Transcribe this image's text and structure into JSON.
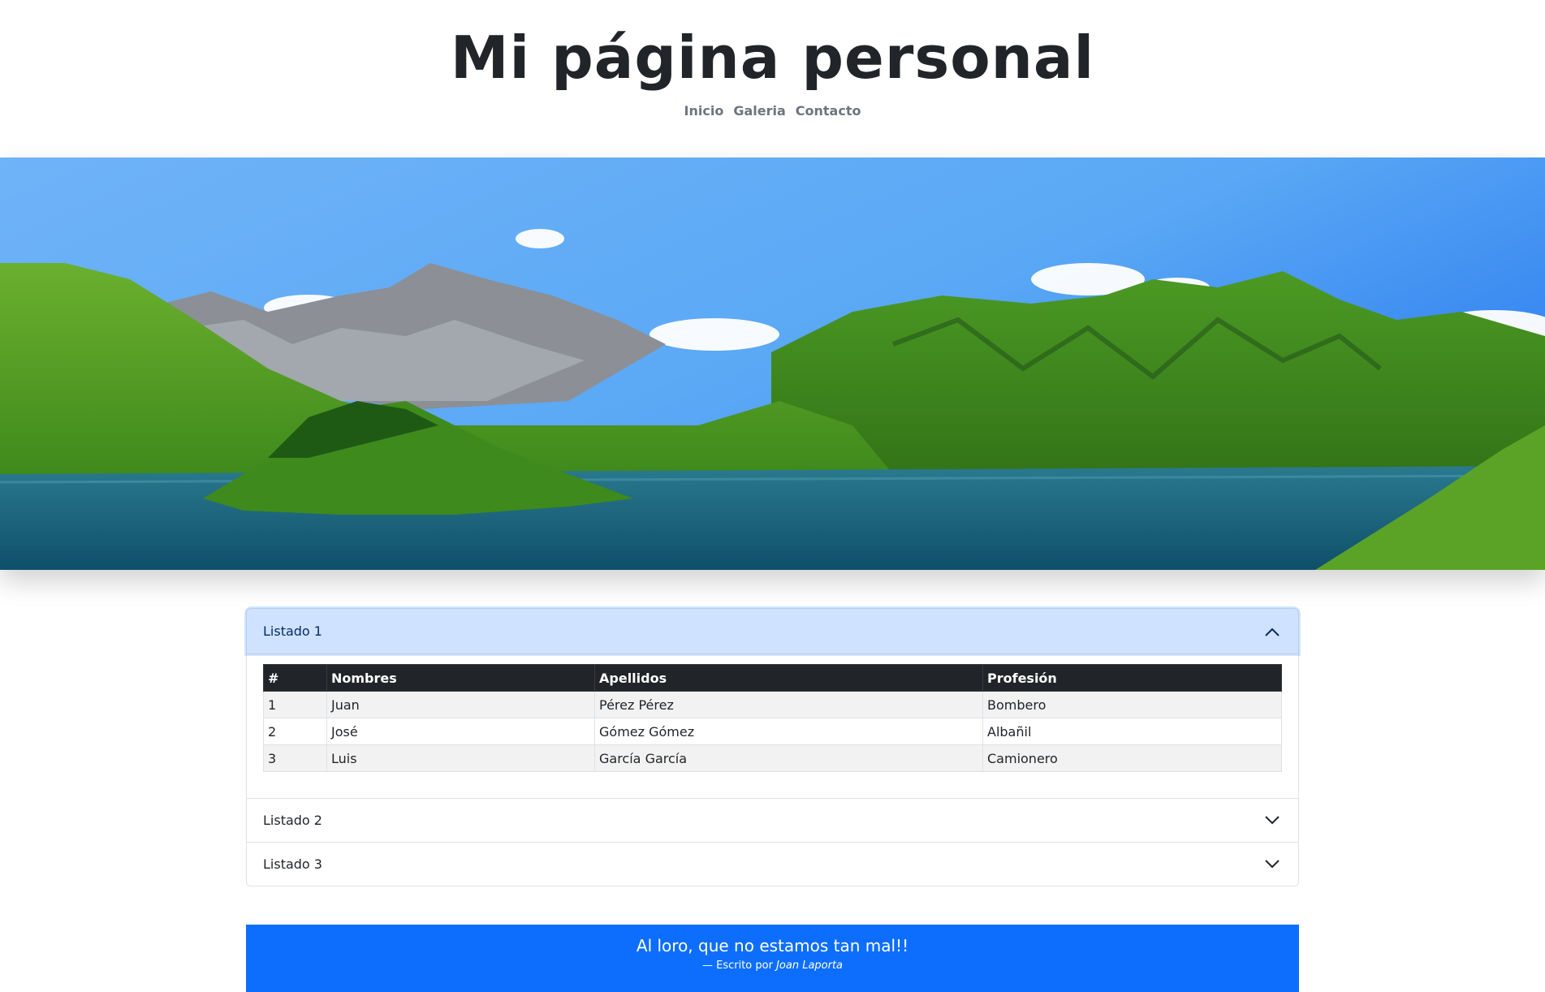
{
  "header": {
    "title": "Mi página personal",
    "nav": [
      "Inicio",
      "Galeria",
      "Contacto"
    ]
  },
  "hero": {
    "alt": "Mountain lake panorama"
  },
  "accordion": {
    "items": [
      {
        "label": "Listado 1",
        "expanded": true,
        "table": {
          "headers": [
            "#",
            "Nombres",
            "Apellidos",
            "Profesión"
          ],
          "rows": [
            [
              "1",
              "Juan",
              "Pérez Pérez",
              "Bombero"
            ],
            [
              "2",
              "José",
              "Gómez Gómez",
              "Albañil"
            ],
            [
              "3",
              "Luis",
              "García García",
              "Camionero"
            ]
          ]
        }
      },
      {
        "label": "Listado 2",
        "expanded": false
      },
      {
        "label": "Listado 3",
        "expanded": false
      }
    ]
  },
  "quote": {
    "text": "Al loro, que no estamos tan mal!!",
    "footer_prefix": "— Escrito por",
    "author": "Joan Laporta"
  },
  "colors": {
    "primary": "#0d6efd",
    "accordion_active_bg": "#cfe2ff",
    "table_header_bg": "#212529"
  }
}
